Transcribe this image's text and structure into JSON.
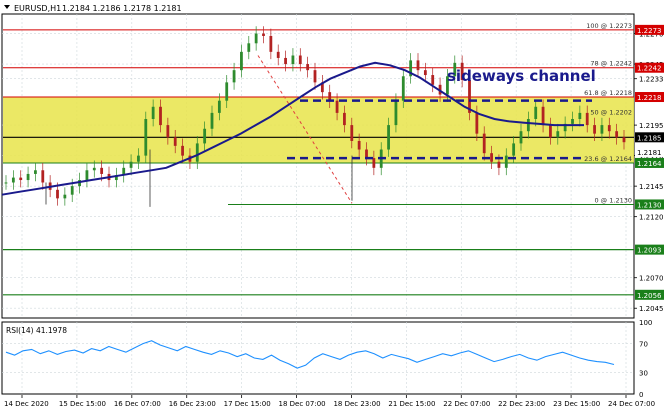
{
  "header": {
    "symbol": "EURUSD,H1",
    "ohlc": "1.2184 1.2186 1.2178 1.2181"
  },
  "colors": {
    "background": "#ffffff",
    "grid": "#cfd8dc",
    "zone": "#e8e44a",
    "bull": "#2e8b2e",
    "bear": "#b22222",
    "ma": "#1a1a8c",
    "channel": "#1a1a8c",
    "rsi": "#1e90ff",
    "fib": "#d40000",
    "green_level": "#1a7f1a",
    "black_level": "#000000",
    "trend": "#e04040"
  },
  "chart_data": {
    "type": "candlestick",
    "symbol": "EURUSD",
    "timeframe": "H1",
    "ylim": [
      1.2037,
      1.2286
    ],
    "yticks": [
      "1.2270",
      "1.2245",
      "1.2233",
      "1.2195",
      "1.2170",
      "1.2145",
      "1.2120",
      "1.2070",
      "1.2045"
    ],
    "x_labels": [
      "14 Dec 2020",
      "15 Dec 15:00",
      "16 Dec 07:00",
      "16 Dec 23:00",
      "17 Dec 15:00",
      "18 Dec 07:00",
      "18 Dec 23:00",
      "21 Dec 15:00",
      "22 Dec 07:00",
      "22 Dec 23:00",
      "23 Dec 15:00",
      "24 Dec 07:00"
    ],
    "annotation": "sideways channel",
    "zone": {
      "low": 1.2164,
      "high": 1.2218
    },
    "fib_levels": [
      {
        "pct": "100",
        "price": 1.2273,
        "label": "100 @ 1.2273",
        "tag": "1.2273"
      },
      {
        "pct": "78",
        "price": 1.2242,
        "label": "78 @ 1.2242",
        "tag": "1.2242"
      },
      {
        "pct": "61.8",
        "price": 1.2218,
        "label": "61.8 @ 1.2218",
        "tag": "1.2218"
      },
      {
        "pct": "50",
        "price": 1.2202,
        "label": "50 @ 1.2202",
        "tag": ""
      },
      {
        "pct": "38.2",
        "price": 1.2185,
        "label": "",
        "tag": ""
      },
      {
        "pct": "23.6",
        "price": 1.2164,
        "label": "23.6 @ 1.2164",
        "tag": "1.2164"
      },
      {
        "pct": "0",
        "price": 1.213,
        "label": "0 @ 1.2130",
        "tag": "1.2130"
      }
    ],
    "current_price": 1.2181,
    "current_tag": "1.2181",
    "level_tag": "1.2185",
    "support_levels": [
      {
        "price": 1.2093,
        "tag": "1.2093"
      },
      {
        "price": 1.2056,
        "tag": "1.2056"
      }
    ],
    "channel": {
      "upper": 1.2215,
      "lower": 1.2168
    },
    "price_path": [
      1.2148,
      1.2152,
      1.215,
      1.2155,
      1.2158,
      1.2148,
      1.2142,
      1.2135,
      1.2138,
      1.2145,
      1.215,
      1.2158,
      1.216,
      1.2155,
      1.215,
      1.2154,
      1.216,
      1.2165,
      1.217,
      1.22,
      1.221,
      1.2195,
      1.2185,
      1.2178,
      1.217,
      1.2165,
      1.218,
      1.2192,
      1.2205,
      1.2215,
      1.223,
      1.224,
      1.2255,
      1.2262,
      1.227,
      1.2268,
      1.2255,
      1.225,
      1.2245,
      1.2252,
      1.2245,
      1.224,
      1.223,
      1.2222,
      1.2215,
      1.2205,
      1.2195,
      1.2182,
      1.2175,
      1.2168,
      1.216,
      1.2175,
      1.2195,
      1.2215,
      1.2235,
      1.2248,
      1.224,
      1.2236,
      1.2228,
      1.222,
      1.2235,
      1.2246,
      1.2232,
      1.2205,
      1.2188,
      1.2172,
      1.2165,
      1.216,
      1.217,
      1.218,
      1.219,
      1.22,
      1.221,
      1.2195,
      1.2185,
      1.219,
      1.2196,
      1.22,
      1.2205,
      1.2195,
      1.2188,
      1.2195,
      1.219,
      1.2185,
      1.2181
    ],
    "ma_path": [
      1.2138,
      1.214,
      1.2142,
      1.2144,
      1.2146,
      1.2148,
      1.215,
      1.2152,
      1.2154,
      1.2156,
      1.2158,
      1.216,
      1.2165,
      1.217,
      1.2176,
      1.2182,
      1.2188,
      1.2195,
      1.2202,
      1.221,
      1.2218,
      1.2226,
      1.2233,
      1.2238,
      1.2243,
      1.2246,
      1.2244,
      1.224,
      1.2234,
      1.2226,
      1.2218,
      1.221,
      1.2204,
      1.22,
      1.2198,
      1.2197,
      1.2196,
      1.2195,
      1.2195,
      1.2195
    ],
    "rsi": {
      "label": "RSI(14) 41.1978",
      "value": 41.1978,
      "ylim": [
        0,
        100
      ],
      "yticks": [
        "100",
        "70",
        "30",
        "0"
      ],
      "values": [
        58,
        54,
        60,
        62,
        56,
        60,
        55,
        59,
        61,
        57,
        63,
        60,
        66,
        62,
        58,
        64,
        70,
        74,
        68,
        64,
        60,
        66,
        62,
        58,
        55,
        60,
        57,
        52,
        56,
        50,
        48,
        54,
        47,
        42,
        36,
        40,
        50,
        56,
        52,
        48,
        54,
        58,
        60,
        56,
        50,
        55,
        52,
        49,
        44,
        48,
        52,
        56,
        53,
        57,
        60,
        55,
        50,
        45,
        48,
        52,
        55,
        50,
        47,
        52,
        55,
        58,
        54,
        50,
        47,
        45,
        44,
        41
      ]
    }
  }
}
